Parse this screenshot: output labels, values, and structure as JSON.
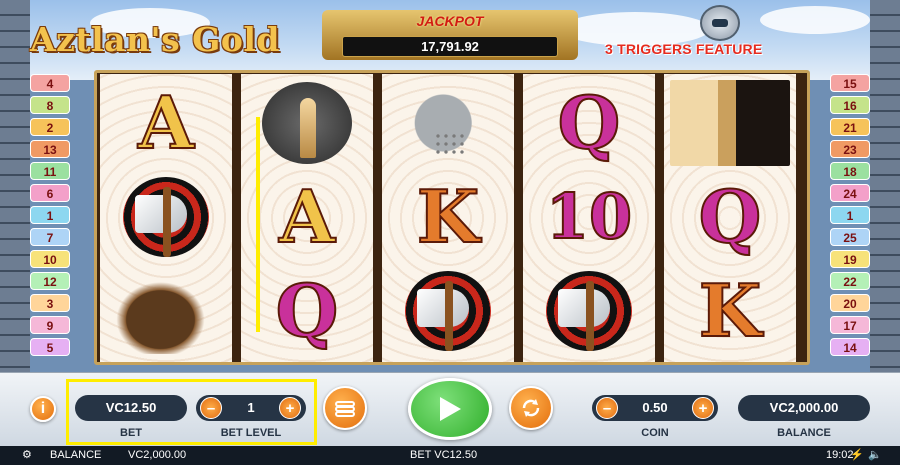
{
  "header": {
    "logo_text": "Aztlan's Gold",
    "jackpot_label": "JACKPOT",
    "jackpot_value": "17,791.92",
    "feature_text": "3 TRIGGERS FEATURE"
  },
  "reels": [
    [
      "A",
      "axe",
      "eagle"
    ],
    [
      "mask",
      "A",
      "Q"
    ],
    [
      "warrior",
      "K",
      "axe"
    ],
    [
      "Q",
      "10",
      "axe"
    ],
    [
      "princess",
      "Q",
      "K"
    ]
  ],
  "paylines_left": [
    "4",
    "8",
    "2",
    "13",
    "11",
    "6",
    "1",
    "7",
    "10",
    "12",
    "3",
    "9",
    "5"
  ],
  "paylines_right": [
    "15",
    "16",
    "21",
    "23",
    "18",
    "24",
    "1",
    "25",
    "19",
    "22",
    "20",
    "17",
    "14"
  ],
  "payline_colors": [
    "#f4a3a1",
    "#c5e38a",
    "#f6c35a",
    "#f09a64",
    "#9be0a0",
    "#f3a0c9",
    "#8dd7f0",
    "#aed4f6",
    "#f7e27a",
    "#b4f0b6",
    "#ffd59a",
    "#f5b8d8",
    "#e6b0f3"
  ],
  "controls": {
    "bet_value": "VC12.50",
    "bet_label": "BET",
    "bet_level_value": "1",
    "bet_level_label": "BET LEVEL",
    "coin_value": "0.50",
    "coin_label": "COIN",
    "balance_value": "VC2,000.00",
    "balance_label": "BALANCE",
    "minus": "–",
    "plus": "+",
    "info": "i"
  },
  "status": {
    "balance_label": "BALANCE",
    "balance_value": "VC2,000.00",
    "bet_text": "BET VC12.50",
    "time": "19:02"
  },
  "colors": {
    "accent_orange": "#e36e0c",
    "spin_green": "#2fae2a",
    "highlight_yellow": "#ffed00"
  }
}
